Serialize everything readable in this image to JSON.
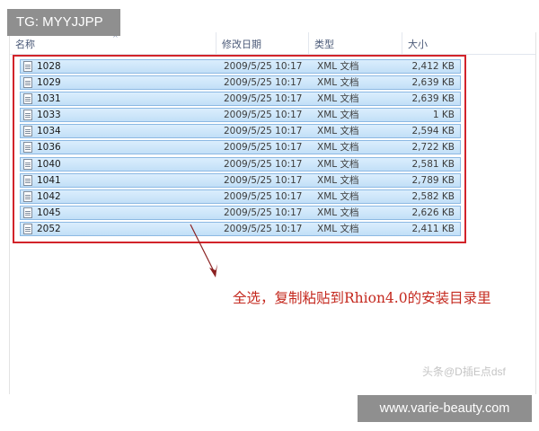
{
  "overlay": {
    "tag": "TG: MYYJJPP",
    "site": "www.varie-beauty.com",
    "watermark": "头条@D插E点dsf"
  },
  "columns": {
    "name": "名称",
    "date": "修改日期",
    "type": "类型",
    "size": "大小"
  },
  "files": [
    {
      "name": "1028",
      "date": "2009/5/25 10:17",
      "type": "XML 文档",
      "size": "2,412 KB"
    },
    {
      "name": "1029",
      "date": "2009/5/25 10:17",
      "type": "XML 文档",
      "size": "2,639 KB"
    },
    {
      "name": "1031",
      "date": "2009/5/25 10:17",
      "type": "XML 文档",
      "size": "2,639 KB"
    },
    {
      "name": "1033",
      "date": "2009/5/25 10:17",
      "type": "XML 文档",
      "size": "1 KB"
    },
    {
      "name": "1034",
      "date": "2009/5/25 10:17",
      "type": "XML 文档",
      "size": "2,594 KB"
    },
    {
      "name": "1036",
      "date": "2009/5/25 10:17",
      "type": "XML 文档",
      "size": "2,722 KB"
    },
    {
      "name": "1040",
      "date": "2009/5/25 10:17",
      "type": "XML 文档",
      "size": "2,581 KB"
    },
    {
      "name": "1041",
      "date": "2009/5/25 10:17",
      "type": "XML 文档",
      "size": "2,789 KB"
    },
    {
      "name": "1042",
      "date": "2009/5/25 10:17",
      "type": "XML 文档",
      "size": "2,582 KB"
    },
    {
      "name": "1045",
      "date": "2009/5/25 10:17",
      "type": "XML 文档",
      "size": "2,626 KB"
    },
    {
      "name": "2052",
      "date": "2009/5/25 10:17",
      "type": "XML 文档",
      "size": "2,411 KB"
    }
  ],
  "annotation": "全选，复制粘贴到Rhion4.0的安装目录里",
  "icons": {
    "file": "xml-document-icon",
    "sort": "sort-ascending-icon"
  },
  "colors": {
    "selection": "#c2dff7",
    "selection_border": "#8cb9e3",
    "highlight_frame": "#d2232a",
    "annotation_text": "#c4281e"
  }
}
